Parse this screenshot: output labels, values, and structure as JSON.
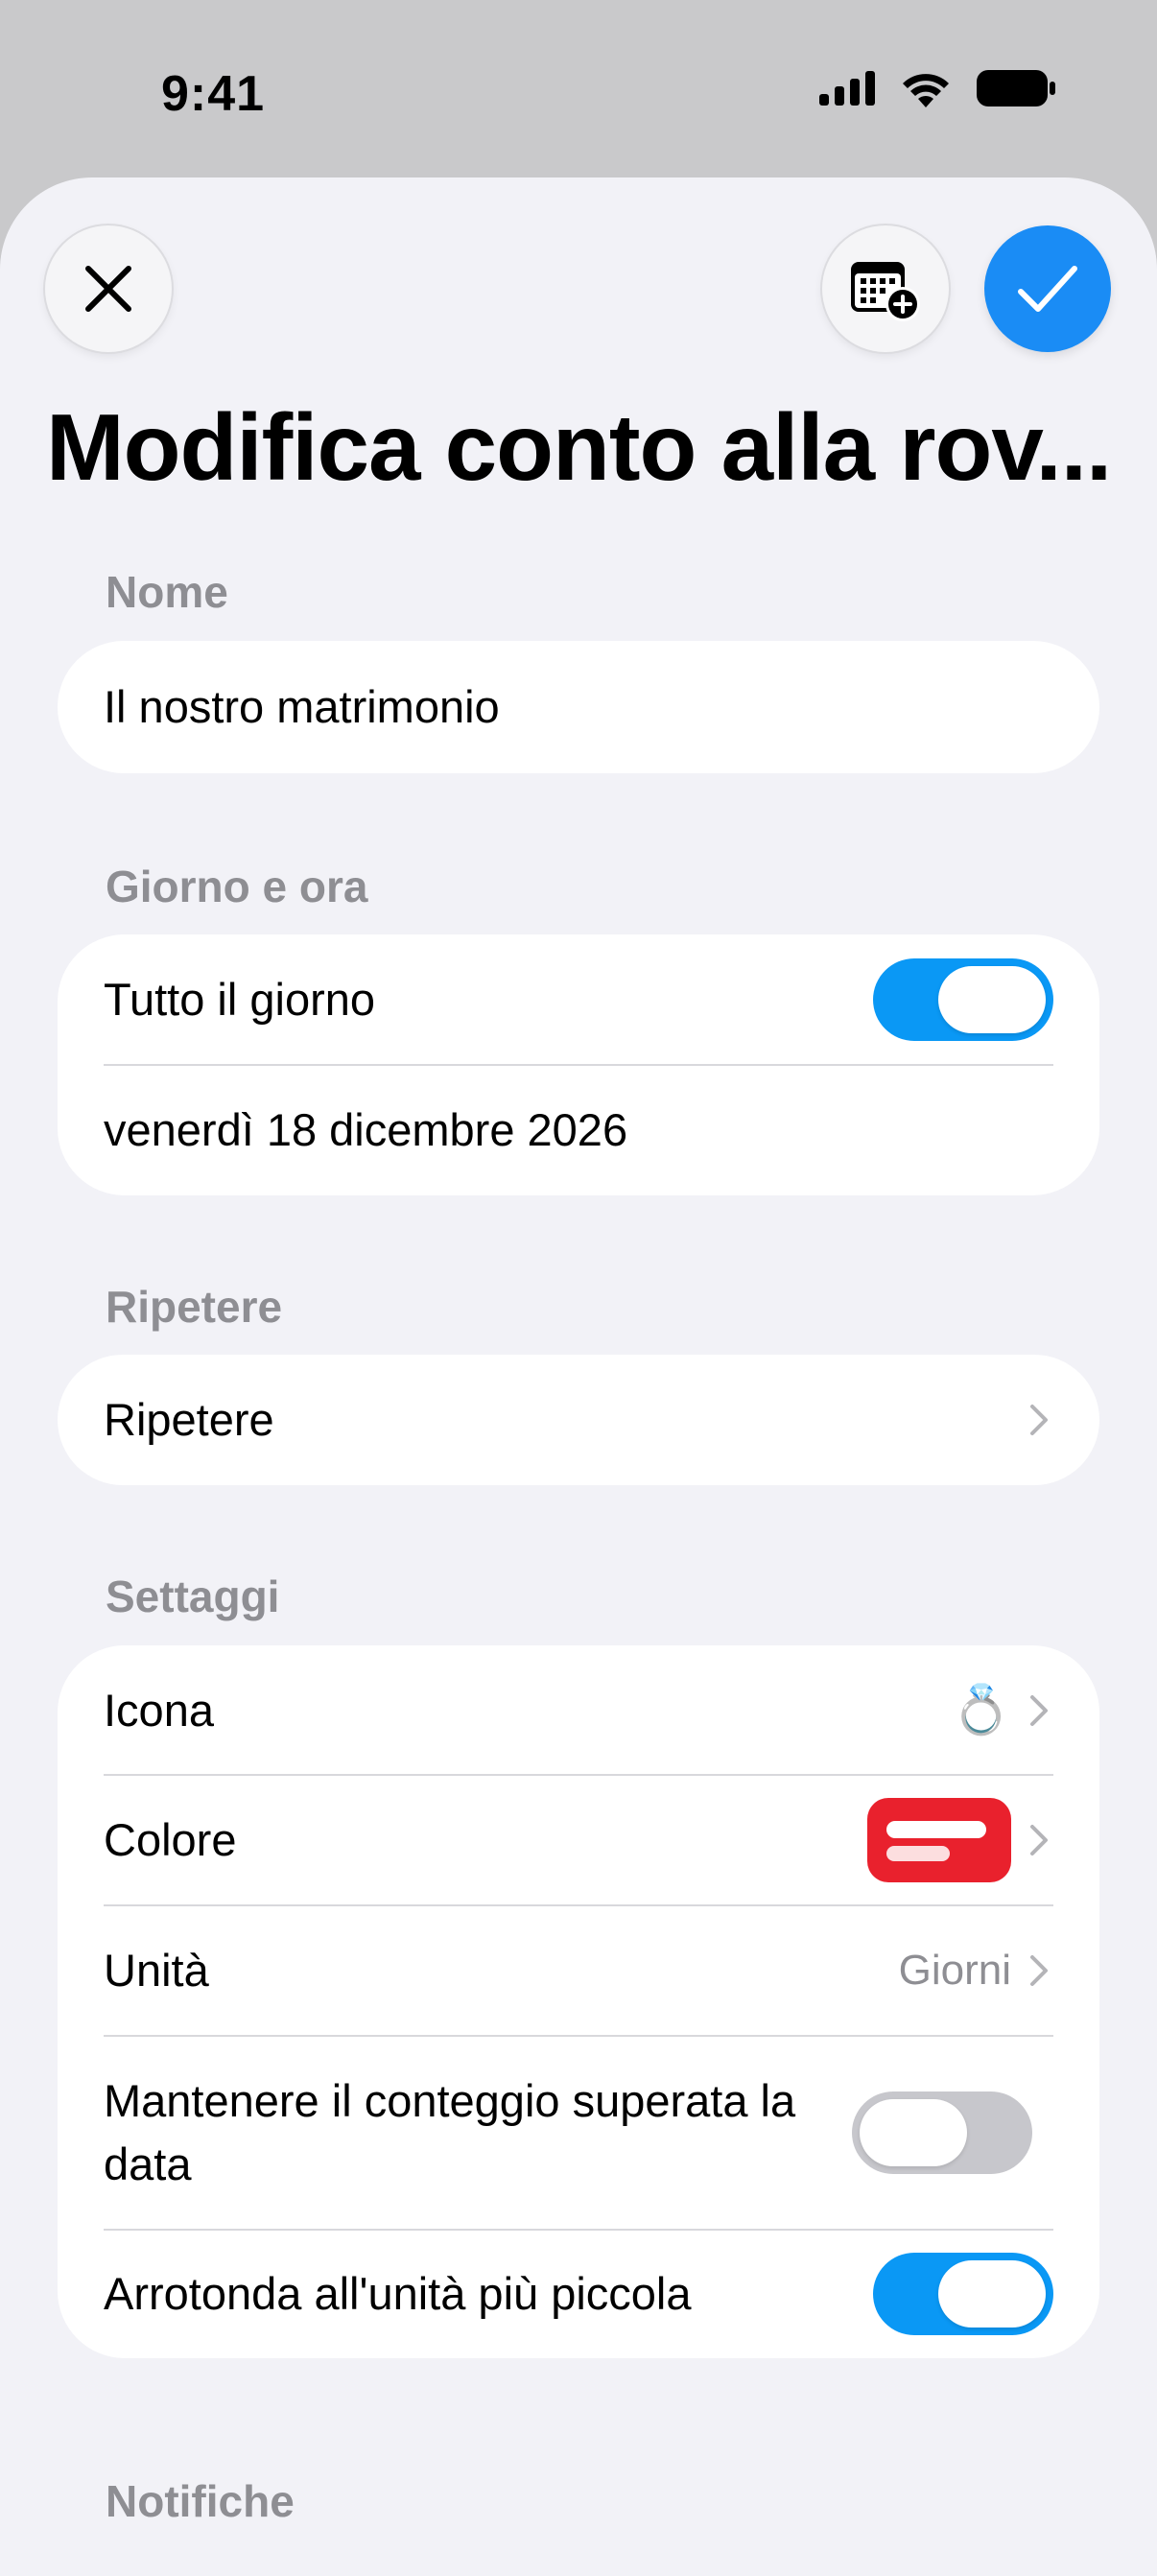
{
  "status_bar": {
    "time": "9:41"
  },
  "header": {
    "title": "Modifica conto alla rov..."
  },
  "sections": {
    "name": {
      "label": "Nome",
      "value": "Il nostro matrimonio"
    },
    "date_time": {
      "label": "Giorno e ora",
      "all_day_label": "Tutto il giorno",
      "all_day_on": true,
      "date": "venerdì 18 dicembre 2026"
    },
    "repeat": {
      "label": "Ripetere",
      "row_label": "Ripetere"
    },
    "settings": {
      "label": "Settaggi",
      "icon_label": "Icona",
      "icon_value": "💍",
      "color_label": "Colore",
      "color_value": "#e9212d",
      "unit_label": "Unità",
      "unit_value": "Giorni",
      "keep_count_label": "Mantenere il conteggio superata la data",
      "keep_count_on": false,
      "round_label": "Arrotonda all'unità più piccola",
      "round_on": true
    },
    "notifications": {
      "label": "Notifiche"
    }
  },
  "colors": {
    "accent": "#1a8cf5",
    "toggle_on": "#0a98f5",
    "toggle_off": "#c7c7cc",
    "background": "#f2f2f7"
  },
  "icons": {
    "close": "close-icon",
    "calendar_add": "calendar-add-icon",
    "confirm": "checkmark-icon",
    "chevron": "chevron-right-icon"
  }
}
